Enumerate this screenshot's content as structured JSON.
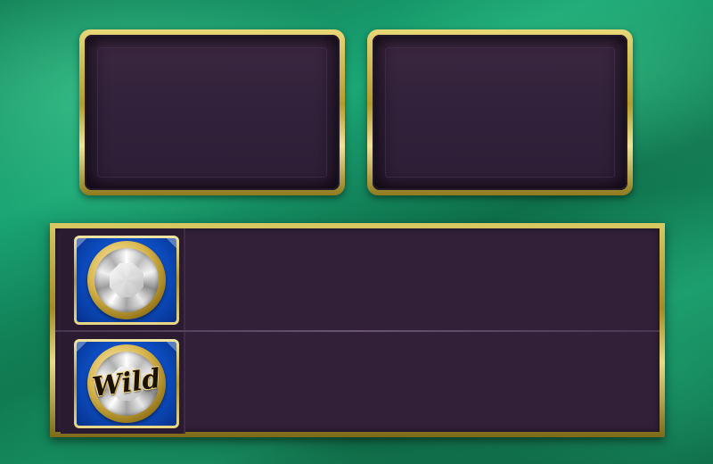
{
  "panels": [
    {
      "id": "left",
      "content": ""
    },
    {
      "id": "right",
      "content": ""
    }
  ],
  "paytable": {
    "rows": [
      {
        "symbol": "diamond",
        "icon": "diamond-coin-icon",
        "label": ""
      },
      {
        "symbol": "wild",
        "icon": "wild-diamond-coin-icon",
        "label": "Wild"
      }
    ]
  },
  "colors": {
    "background": "#14875c",
    "panel_fill": "#32213a",
    "gold_frame": "#c9b24a",
    "tile_blue": "#1157d0"
  }
}
